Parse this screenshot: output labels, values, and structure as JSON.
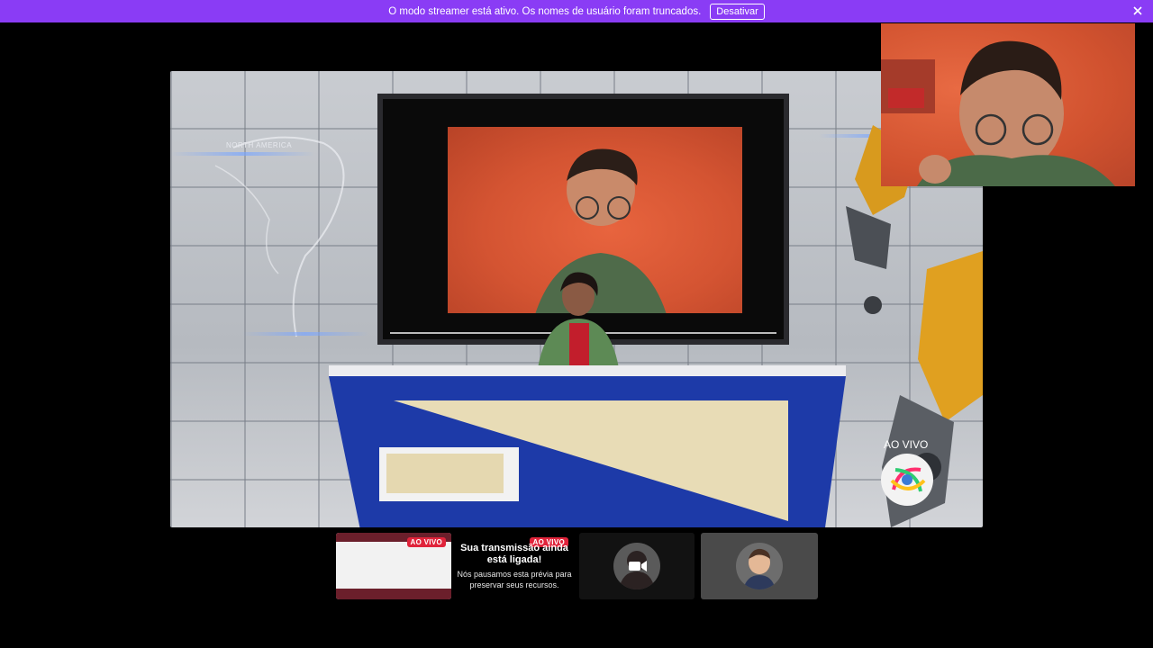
{
  "banner": {
    "message": "O modo streamer está ativo. Os nomes de usuário foram truncados.",
    "button_label": "Desativar"
  },
  "stage": {
    "map_label_na": "NORTH AMERICA",
    "live_label": "AO VIVO"
  },
  "thumbnails": {
    "live_badge_1": "AO VIVO",
    "live_badge_2": "AO VIVO",
    "paused_title": "Sua transmissão ainda está ligada!",
    "paused_text": "Nós pausamos esta prévia para preservar seus recursos."
  },
  "colors": {
    "banner": "#8a3cf5",
    "live": "#e0243b"
  }
}
